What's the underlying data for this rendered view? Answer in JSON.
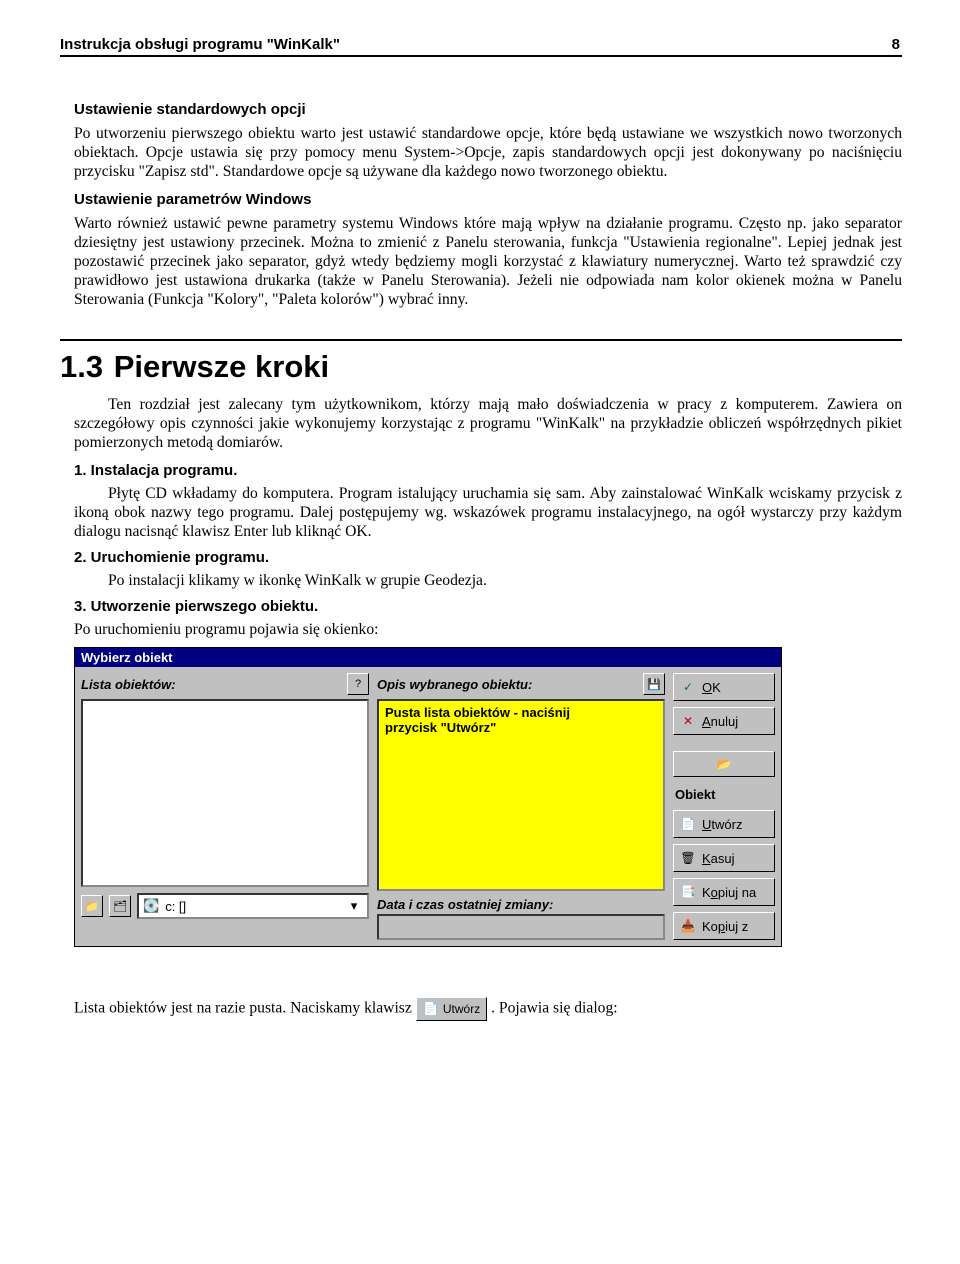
{
  "header": {
    "title": "Instrukcja obsługi programu \"WinKalk\"",
    "page_number": "8"
  },
  "section_a": {
    "heading": "Ustawienie standardowych opcji",
    "p": "Po utworzeniu pierwszego obiektu warto jest ustawić standardowe opcje, które będą ustawiane we wszystkich nowo tworzonych obiektach. Opcje ustawia się przy pomocy menu System->Opcje,  zapis standardowych opcji jest dokonywany po naciśnięciu przycisku \"Zapisz std\". Standardowe opcje są używane dla każdego nowo tworzonego obiektu."
  },
  "section_b": {
    "heading": "Ustawienie parametrów Windows",
    "p": "Warto również ustawić pewne parametry systemu Windows które mają wpływ na działanie programu. Często np. jako separator dziesiętny jest ustawiony przecinek. Można to zmienić z Panelu sterowania, funkcja \"Ustawienia regionalne\". Lepiej jednak jest pozostawić przecinek jako separator, gdyż wtedy będziemy mogli korzystać z klawiatury numerycznej. Warto też sprawdzić czy prawidłowo jest ustawiona drukarka (także w Panelu Sterowania). Jeżeli nie odpowiada nam kolor okienek  można w Panelu Sterowania (Funkcja \"Kolory\", \"Paleta kolorów\") wybrać inny."
  },
  "h2": {
    "number": "1.3",
    "title": "Pierwsze kroki",
    "intro": "Ten rozdział jest zalecany tym użytkownikom, którzy mają mało doświadczenia w pracy z komputerem. Zawiera on szczegółowy opis czynności jakie wykonujemy korzystając z programu \"WinKalk\" na przykładzie obliczeń współrzędnych pikiet pomierzonych metodą domiarów."
  },
  "steps": {
    "s1_head": "1. Instalacja programu.",
    "s1_body": "Płytę CD wkładamy do komputera. Program istalujący uruchamia się sam. Aby zainstalować WinKalk wciskamy przycisk z ikoną obok nazwy tego programu. Dalej postępujemy wg. wskazówek programu instalacyjnego, na ogół wystarczy przy każdym dialogu nacisnąć klawisz Enter lub kliknąć OK.",
    "s2_head": "2. Uruchomienie programu.",
    "s2_body": "Po instalacji klikamy w ikonkę WinKalk w grupie Geodezja.",
    "s3_head": "3. Utworzenie pierwszego obiektu.",
    "s3_body": "Po uruchomieniu programu pojawia się okienko:"
  },
  "dialog": {
    "title": "Wybierz obiekt",
    "lista_label": "Lista obiektów:",
    "opis_label": "Opis wybranego obiektu:",
    "desc_line1": "Pusta lista obiektów - naciśnij",
    "desc_line2": "przycisk \"Utwórz\"",
    "drive": "c: []",
    "date_label": "Data i czas ostatniej zmiany:",
    "buttons": {
      "ok": "OK",
      "anuluj": "Anuluj",
      "obiekt": "Obiekt",
      "utworz": "Utwórz",
      "kasuj": "Kasuj",
      "kopiuj_na": "Kopiuj na",
      "kopiuj_z": "Kopiuj z"
    },
    "icons": {
      "help": "?",
      "save": "💾",
      "check": "✓",
      "cross": "✕",
      "folder_open": "📂",
      "file_new": "📄",
      "trash": "🗑",
      "copy_out": "📑",
      "copy_in": "📥",
      "folder_up": "📁",
      "tree": "🗂",
      "drive": "💽",
      "dropdown": "▾"
    }
  },
  "final": {
    "pre": "Lista obiektów jest na razie pusta. Naciskamy klawisz ",
    "btn_label": "Utwórz",
    "post": ". Pojawia się dialog:"
  }
}
